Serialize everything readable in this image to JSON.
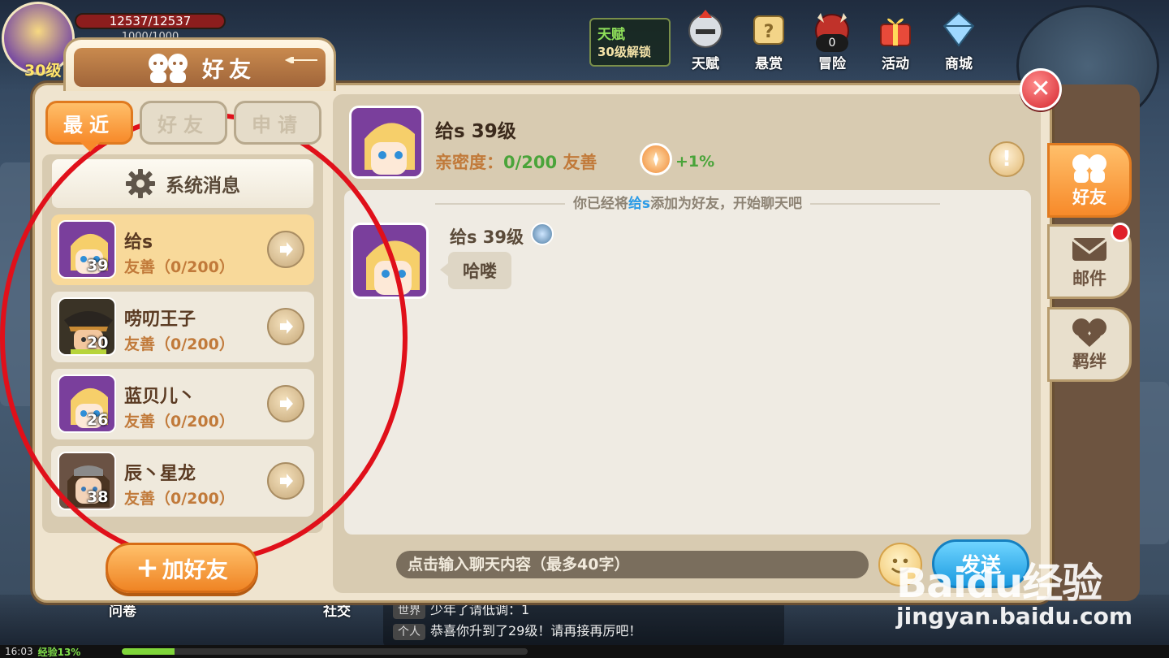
{
  "player": {
    "level": "30级",
    "hp": "12537/12537",
    "mp": "1000/1000"
  },
  "talent": {
    "title": "天赋",
    "subtitle": "30级解锁"
  },
  "top_nav": [
    {
      "label": "天赋",
      "icon": "knight-helmet-icon"
    },
    {
      "label": "悬赏",
      "icon": "scroll-icon"
    },
    {
      "label": "冒险",
      "icon": "demon-icon",
      "count": "0"
    },
    {
      "label": "活动",
      "icon": "gift-icon"
    },
    {
      "label": "商城",
      "icon": "shop-icon"
    }
  ],
  "dialog": {
    "title": "好友",
    "tabs": [
      {
        "label": "最近",
        "active": true
      },
      {
        "label": "好友",
        "active": false
      },
      {
        "label": "申请",
        "active": false
      }
    ],
    "system_message_label": "系统消息",
    "friends": [
      {
        "name": "给s",
        "level": "39",
        "status": "友善（0/200）",
        "selected": true,
        "avatar_color": "#7a3f9c",
        "hair_color": "#f6cf6a"
      },
      {
        "name": "唠叨王子",
        "level": "20",
        "status": "友善（0/200）",
        "selected": false,
        "avatar_color": "#3a3326",
        "hair_color": "#c88a34"
      },
      {
        "name": "蓝贝儿丶",
        "level": "26",
        "status": "友善（0/200）",
        "selected": false,
        "avatar_color": "#7a3f9c",
        "hair_color": "#f6cf6a"
      },
      {
        "name": "辰丶星龙",
        "level": "38",
        "status": "友善（0/200）",
        "selected": false,
        "avatar_color": "#6a5244",
        "hair_color": "#4a3422"
      }
    ],
    "add_friend_label": "加好友"
  },
  "chat": {
    "header_name": "给s  39级",
    "intimacy_label": "亲密度：",
    "intimacy_value": "0/200",
    "intimacy_level": "友善",
    "intimacy_bonus": "+1%",
    "notice_prefix": "你已经将",
    "notice_name": "给s",
    "notice_suffix": "添加为好友，开始聊天吧",
    "message_sender": "给s 39级",
    "message_text": "哈喽",
    "input_placeholder": "点击输入聊天内容（最多40字）",
    "send_label": "发送"
  },
  "side_tabs": [
    {
      "label": "好友",
      "icon": "friends-icon",
      "active": true
    },
    {
      "label": "邮件",
      "icon": "mail-icon",
      "active": false
    },
    {
      "label": "羁绊",
      "icon": "bond-icon",
      "active": false
    }
  ],
  "bottom": {
    "quest_label": "问卷",
    "social_label": "社交",
    "chat_lines": [
      {
        "tag": "世界",
        "text": "少年了请低调：1"
      },
      {
        "tag": "个人",
        "text": "恭喜你升到了29级！请再接再厉吧！"
      }
    ],
    "time": "16:03",
    "exp_label": "经验13%",
    "exp_percent": 13
  },
  "watermark": {
    "logo": "Baidu经验",
    "url": "jingyan.baidu.com"
  },
  "colors": {
    "accent_orange": "#f78a2a",
    "send_blue": "#1c9be0",
    "intimacy_green": "#4aa43a",
    "annotation_red": "#e0101a"
  }
}
